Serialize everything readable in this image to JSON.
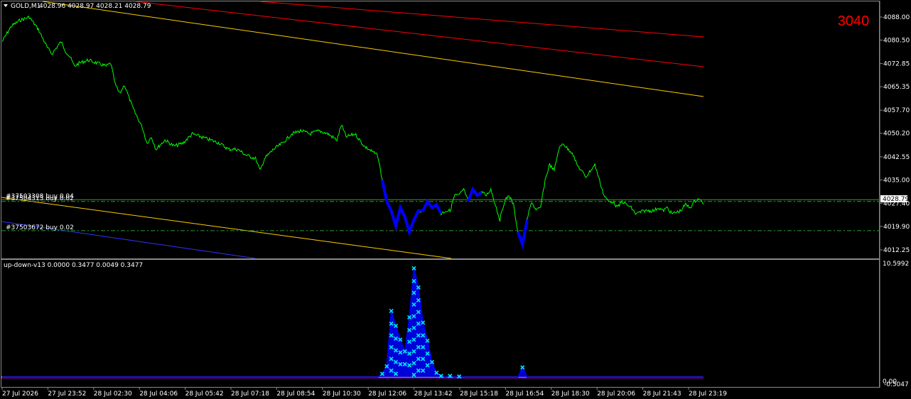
{
  "header": {
    "symbol": "GOLD,M1",
    "ohlc": "4028.96 4028.97 4028.21 4028.79",
    "counter": "3040"
  },
  "price_axis": {
    "labels": [
      "4088.00",
      "4080.50",
      "4072.85",
      "4065.35",
      "4057.70",
      "4050.20",
      "4042.55",
      "4035.00",
      "4027.40",
      "4019.90",
      "4012.25"
    ],
    "current_price": "4028.79"
  },
  "orders": [
    {
      "label": "#37503308 buy 0.04",
      "price": 4028.6
    },
    {
      "label": "#37504313 buy 0.02",
      "price": 4028.0
    },
    {
      "label": "#37503672 buy 0.02",
      "price": 4018.5
    }
  ],
  "indicator": {
    "title": "up-down-v13 0.0000 0.3477 0.0049 0.3477",
    "max_label": "10.5992",
    "zero_label": "0.00",
    "min_label": "-0.5047"
  },
  "time_axis": [
    "27 Jul 2026",
    "27 Jul 23:52",
    "28 Jul 02:30",
    "28 Jul 04:06",
    "28 Jul 05:42",
    "28 Jul 07:18",
    "28 Jul 08:54",
    "28 Jul 10:30",
    "28 Jul 12:06",
    "28 Jul 13:42",
    "28 Jul 15:18",
    "28 Jul 16:54",
    "28 Jul 18:30",
    "28 Jul 20:06",
    "28 Jul 21:43",
    "28 Jul 23:19"
  ],
  "chart_data": {
    "type": "line",
    "ylim": [
      4009.5,
      4091.5
    ],
    "price_points": [
      [
        0,
        4080
      ],
      [
        2,
        4085
      ],
      [
        4,
        4087
      ],
      [
        6,
        4088
      ],
      [
        8,
        4084
      ],
      [
        9,
        4081
      ],
      [
        10,
        4078
      ],
      [
        11,
        4076
      ],
      [
        13,
        4080
      ],
      [
        14,
        4077
      ],
      [
        15,
        4075
      ],
      [
        16,
        4072
      ],
      [
        17,
        4073
      ],
      [
        19,
        4074
      ],
      [
        21,
        4073
      ],
      [
        23,
        4072
      ],
      [
        24,
        4073
      ],
      [
        25,
        4066
      ],
      [
        26,
        4063
      ],
      [
        27,
        4066
      ],
      [
        28,
        4062
      ],
      [
        29,
        4058
      ],
      [
        30,
        4055
      ],
      [
        31,
        4052
      ],
      [
        32,
        4047
      ],
      [
        33,
        4049
      ],
      [
        34,
        4045
      ],
      [
        36,
        4048
      ],
      [
        38,
        4046
      ],
      [
        40,
        4047
      ],
      [
        42,
        4050
      ],
      [
        44,
        4049
      ],
      [
        46,
        4048
      ],
      [
        48,
        4047
      ],
      [
        50,
        4045
      ],
      [
        52,
        4045
      ],
      [
        54,
        4043
      ],
      [
        56,
        4042
      ],
      [
        57,
        4038
      ],
      [
        58,
        4042
      ],
      [
        60,
        4045
      ],
      [
        62,
        4047
      ],
      [
        64,
        4050
      ],
      [
        66,
        4051
      ],
      [
        68,
        4050
      ],
      [
        70,
        4051
      ],
      [
        72,
        4050
      ],
      [
        74,
        4048
      ],
      [
        75,
        4053
      ],
      [
        76,
        4049
      ],
      [
        78,
        4050
      ],
      [
        80,
        4046
      ],
      [
        82,
        4044
      ],
      [
        83,
        4043
      ],
      [
        84,
        4035
      ],
      [
        85,
        4028
      ],
      [
        86,
        4025
      ],
      [
        87,
        4020
      ],
      [
        88,
        4026
      ],
      [
        89,
        4023
      ],
      [
        90,
        4018
      ],
      [
        91,
        4022
      ],
      [
        92,
        4025
      ],
      [
        93,
        4025
      ],
      [
        94,
        4028
      ],
      [
        95,
        4026
      ],
      [
        96,
        4027
      ],
      [
        97,
        4024
      ],
      [
        98,
        4025
      ],
      [
        99,
        4025
      ],
      [
        100,
        4030
      ],
      [
        101,
        4030
      ],
      [
        102,
        4032
      ],
      [
        103,
        4028
      ],
      [
        104,
        4032
      ],
      [
        105,
        4030
      ],
      [
        106,
        4031
      ],
      [
        107,
        4030
      ],
      [
        108,
        4032
      ],
      [
        109,
        4027
      ],
      [
        110,
        4022
      ],
      [
        111,
        4028
      ],
      [
        112,
        4030
      ],
      [
        113,
        4027
      ],
      [
        114,
        4018
      ],
      [
        115,
        4014
      ],
      [
        116,
        4022
      ],
      [
        117,
        4028
      ],
      [
        118,
        4025
      ],
      [
        119,
        4026
      ],
      [
        120,
        4035
      ],
      [
        121,
        4040
      ],
      [
        122,
        4038
      ],
      [
        123,
        4045
      ],
      [
        124,
        4047
      ],
      [
        125,
        4045
      ],
      [
        126,
        4044
      ],
      [
        127,
        4040
      ],
      [
        128,
        4038
      ],
      [
        129,
        4036
      ],
      [
        130,
        4038
      ],
      [
        131,
        4040
      ],
      [
        132,
        4035
      ],
      [
        133,
        4030
      ],
      [
        134,
        4028
      ],
      [
        135,
        4028
      ],
      [
        136,
        4026
      ],
      [
        137,
        4028
      ],
      [
        138,
        4027
      ],
      [
        139,
        4026
      ],
      [
        140,
        4024
      ],
      [
        142,
        4025
      ],
      [
        144,
        4025
      ],
      [
        145,
        4026
      ],
      [
        146,
        4025
      ],
      [
        147,
        4026
      ],
      [
        148,
        4024
      ],
      [
        150,
        4025
      ],
      [
        151,
        4027
      ],
      [
        152,
        4026
      ],
      [
        153,
        4028
      ],
      [
        154,
        4029
      ],
      [
        155,
        4027
      ]
    ],
    "x_span": [
      0,
      155
    ],
    "indicator_ylim": [
      -0.5047,
      10.5992
    ],
    "indicator_points": [
      [
        0,
        0.0
      ],
      [
        83,
        0.0
      ],
      [
        84,
        0.3
      ],
      [
        85,
        1.0
      ],
      [
        86,
        6.2
      ],
      [
        87,
        4.8
      ],
      [
        88,
        3.5
      ],
      [
        89,
        2.4
      ],
      [
        90,
        5.6
      ],
      [
        91,
        10.2
      ],
      [
        92,
        8.4
      ],
      [
        93,
        5.1
      ],
      [
        94,
        3.4
      ],
      [
        95,
        1.4
      ],
      [
        96,
        0.4
      ],
      [
        97,
        0.1
      ],
      [
        98,
        0.0
      ],
      [
        99,
        0.1
      ],
      [
        100,
        0.0
      ],
      [
        101,
        0.05
      ],
      [
        102,
        0.0
      ],
      [
        114,
        0.0
      ],
      [
        115,
        0.9
      ],
      [
        116,
        0.0
      ],
      [
        155,
        0.0
      ]
    ]
  },
  "colors": {
    "price_line": "#00ff00",
    "highlight": "#0000ff",
    "marker": "#00e5ff",
    "trend_red": "#ff0000",
    "trend_yellow": "#ffcc00",
    "trend_blue": "#3333ff",
    "order_line": "#2e9e2e",
    "counter": "#ff0000",
    "indicator_baseline": "#ffb000"
  }
}
